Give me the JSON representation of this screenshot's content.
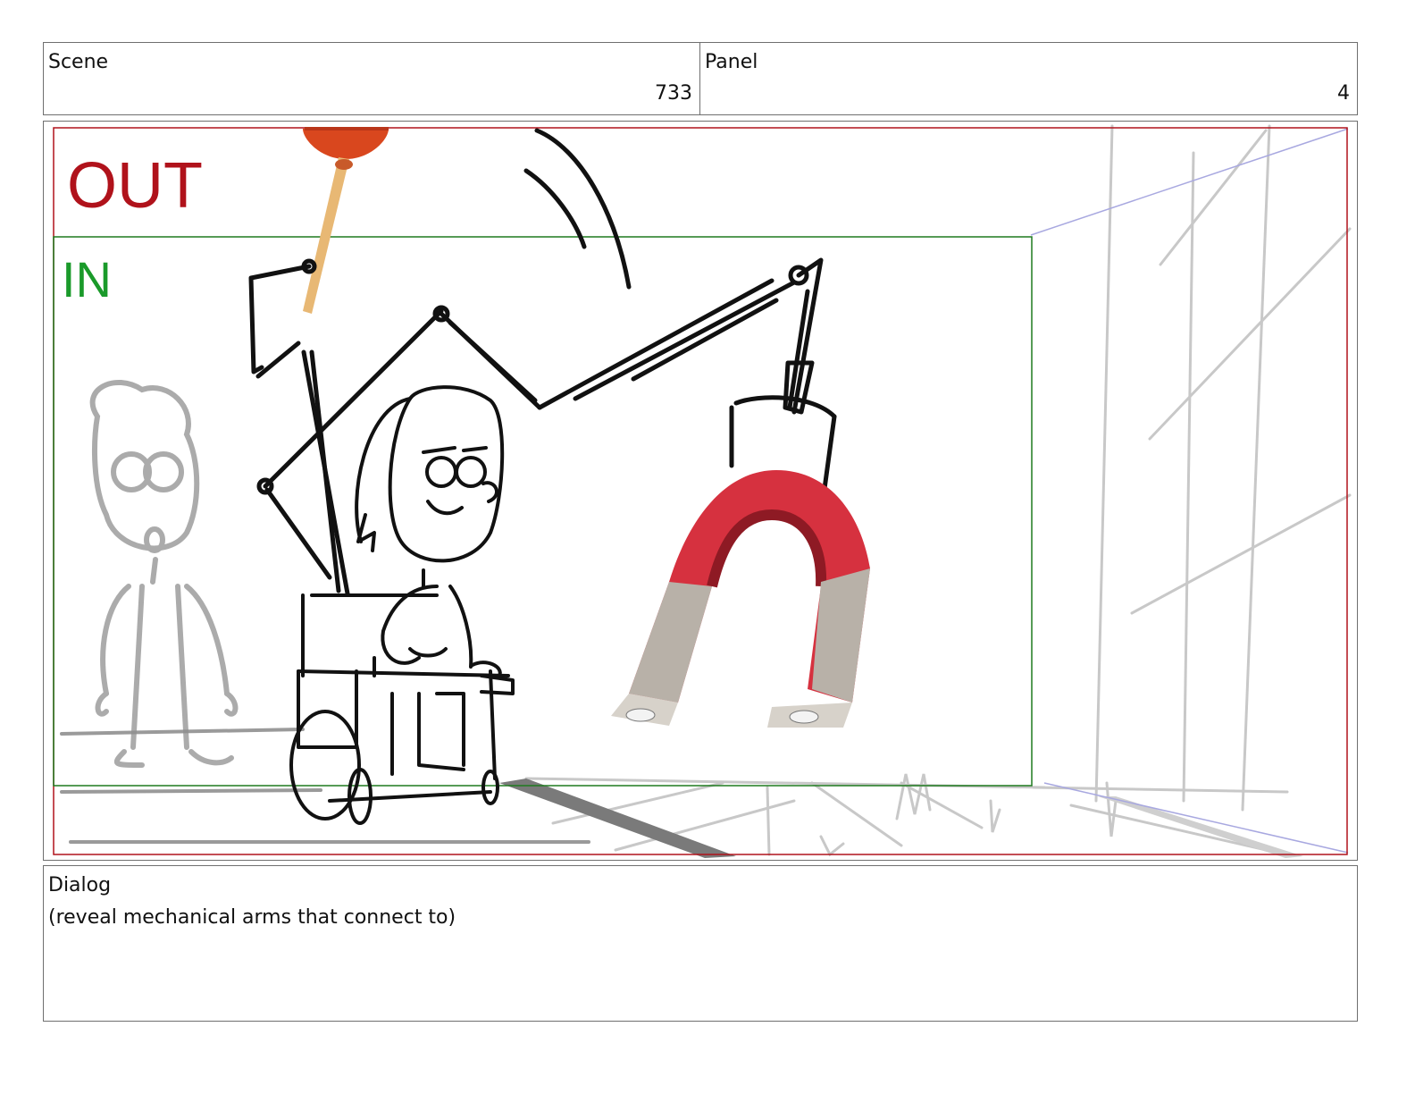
{
  "header": {
    "scene_label": "Scene",
    "scene_number": "733",
    "panel_label": "Panel",
    "panel_number": "4"
  },
  "frame": {
    "out_label": "OUT",
    "in_label": "IN",
    "out_color": "#b0121b",
    "in_color": "#1a9a2a",
    "image_objects": [
      "plunger",
      "horseshoe-magnet",
      "girl-in-wheelchair",
      "mechanical-arms",
      "background-character"
    ]
  },
  "dialog": {
    "label": "Dialog",
    "text": "(reveal mechanical arms that connect to)"
  }
}
